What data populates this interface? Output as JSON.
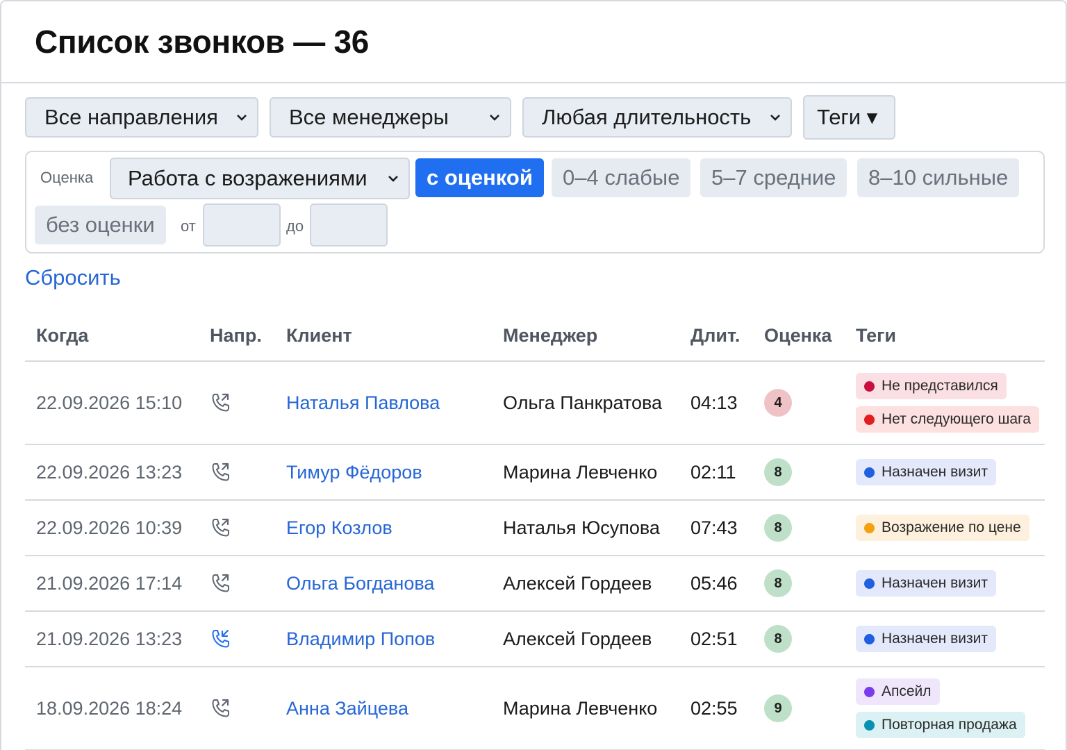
{
  "header": {
    "title": "Список звонков — 36"
  },
  "filters": {
    "direction": "Все направления",
    "manager": "Все менеджеры",
    "duration": "Любая длительность",
    "tags_button": "Теги ▾"
  },
  "score_filter": {
    "label": "Оценка",
    "criterion": "Работа с возражениями",
    "chips": [
      "с оценкой",
      "0–4 слабые",
      "5–7 средние",
      "8–10 сильные",
      "без оценки"
    ],
    "active_chip": "с оценкой",
    "from_label": "от",
    "to_label": "до",
    "from_value": "",
    "to_value": ""
  },
  "reset_label": "Сбросить",
  "table": {
    "headers": [
      "Когда",
      "Напр.",
      "Клиент",
      "Менеджер",
      "Длит.",
      "Оценка",
      "Теги"
    ],
    "rows": [
      {
        "when": "22.09.2026 15:10",
        "direction": "outgoing",
        "client": "Наталья Павлова",
        "manager": "Ольга Панкратова",
        "duration": "04:13",
        "score": "4",
        "tags": [
          {
            "label": "Не представился",
            "dot": "#c8103e",
            "bg": "#fadfe4"
          },
          {
            "label": "Нет следующего шага",
            "dot": "#e11d1d",
            "bg": "#fde0e0"
          }
        ]
      },
      {
        "when": "22.09.2026 13:23",
        "direction": "outgoing",
        "client": "Тимур Фёдоров",
        "manager": "Марина Левченко",
        "duration": "02:11",
        "score": "8",
        "tags": [
          {
            "label": "Назначен визит",
            "dot": "#1f5fe0",
            "bg": "#e3e9fb"
          }
        ]
      },
      {
        "when": "22.09.2026 10:39",
        "direction": "outgoing",
        "client": "Егор Козлов",
        "manager": "Наталья Юсупова",
        "duration": "07:43",
        "score": "8",
        "tags": [
          {
            "label": "Возражение по цене",
            "dot": "#f5a00f",
            "bg": "#fdf0dc"
          }
        ]
      },
      {
        "when": "21.09.2026 17:14",
        "direction": "outgoing",
        "client": "Ольга Богданова",
        "manager": "Алексей Гордеев",
        "duration": "05:46",
        "score": "8",
        "tags": [
          {
            "label": "Назначен визит",
            "dot": "#1f5fe0",
            "bg": "#e3e9fb"
          }
        ]
      },
      {
        "when": "21.09.2026 13:23",
        "direction": "incoming",
        "client": "Владимир Попов",
        "manager": "Алексей Гордеев",
        "duration": "02:51",
        "score": "8",
        "tags": [
          {
            "label": "Назначен визит",
            "dot": "#1f5fe0",
            "bg": "#e3e9fb"
          }
        ]
      },
      {
        "when": "18.09.2026 18:24",
        "direction": "outgoing",
        "client": "Анна Зайцева",
        "manager": "Марина Левченко",
        "duration": "02:55",
        "score": "9",
        "tags": [
          {
            "label": "Апсейл",
            "dot": "#7c3aed",
            "bg": "#efe6fb"
          },
          {
            "label": "Повторная продажа",
            "dot": "#0891b2",
            "bg": "#dcf1f3"
          }
        ]
      }
    ]
  },
  "colors": {
    "accent": "#1f6ff0",
    "link": "#2666d6",
    "score_low_bg": "#efc3c6",
    "score_high_bg": "#bfe0c8",
    "incoming_icon": "#1f6ff0",
    "outgoing_icon": "#5f6670"
  }
}
